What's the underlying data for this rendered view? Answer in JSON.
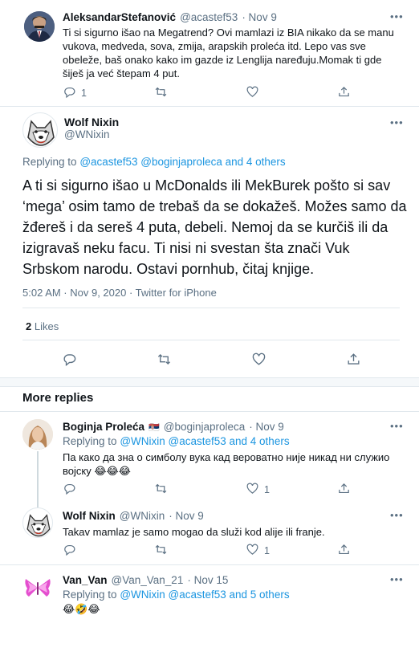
{
  "tweet1": {
    "name": "AleksandarStefanović",
    "handle": "@acastef53",
    "date": "· Nov 9",
    "text": "Ti si sigurno išao na Megatrend? Ovi mamlazi iz BIA nikako da se manu vukova, medveda, sova, zmija, arapskih proleća itd. Lepo vas sve obeleže, baš onako kako im gazde iz Lenglija naređuju.Momak ti gde šiješ ja već štepam 4 put.",
    "reply_count": "1",
    "retweet_count": "",
    "like_count": ""
  },
  "main_tweet": {
    "name": "Wolf Nixin",
    "handle": "@WNixin",
    "replying_prefix": "Replying to",
    "replying_to": "@acastef53 @boginjaproleca and 4 others",
    "text": "A ti si sigurno išao u McDonalds ili MekBurek pošto si sav ‘mega’ osim tamo de trebaš da se dokažeš. Možes samo da žđereš i da sereš 4 puta, debeli. Nemoj da se kurčiš ili da izigravaš neku facu. Ti nisi ni svestan šta znači Vuk Srbskom narodu. Ostavi pornhub, čitaj knjige.",
    "meta": "5:02 AM · Nov 9, 2020 · Twitter for iPhone",
    "likes_count": "2",
    "likes_label": "Likes"
  },
  "more_replies_title": "More replies",
  "replies": [
    {
      "name": "Boginja Proleća",
      "flag": "🇷🇸",
      "handle": "@boginjaproleca",
      "date": "· Nov 9",
      "replying_prefix": "Replying to",
      "replying_to": "@WNixin @acastef53 and 4 others",
      "text": "Па како да зна о симболу вука кад вероватно није никад ни служио војску 😂😂😂",
      "reply_count": "",
      "retweet_count": "",
      "like_count": "1"
    },
    {
      "name": "Wolf Nixin",
      "handle": "@WNixin",
      "date": "· Nov 9",
      "text": "Takav mamlaz je samo mogao da služi kod alije ili franje.",
      "reply_count": "",
      "retweet_count": "",
      "like_count": "1"
    },
    {
      "name": "Van_Van",
      "handle": "@Van_Van_21",
      "date": "· Nov 15",
      "replying_prefix": "Replying to",
      "replying_to": "@WNixin @acastef53 and 5 others",
      "text": "😂🤣😂"
    }
  ],
  "colors": {
    "link": "#1b95e0",
    "muted": "#5b7083",
    "divider": "#e1e8ed"
  },
  "icons": [
    "more-icon",
    "reply-icon",
    "retweet-icon",
    "like-icon",
    "share-icon"
  ]
}
